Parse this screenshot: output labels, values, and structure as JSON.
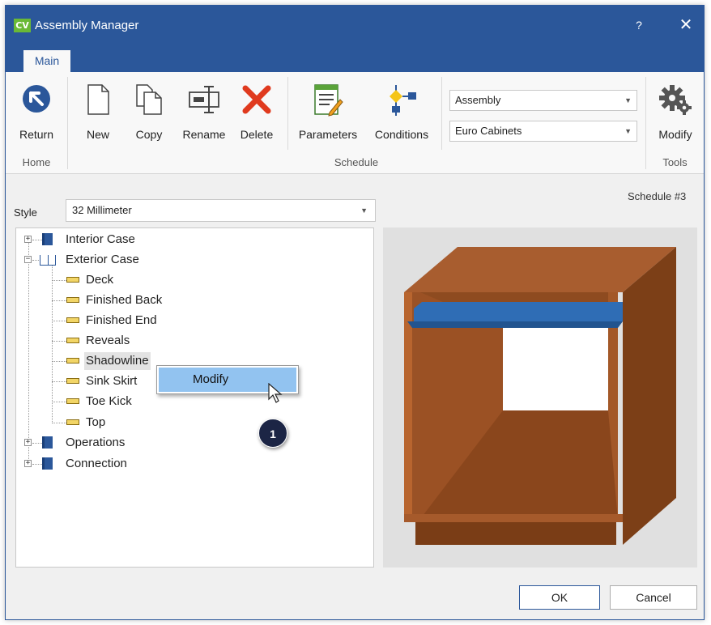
{
  "window": {
    "title": "Assembly Manager",
    "logo": "CV",
    "help": "?",
    "close": "✕"
  },
  "tabs": [
    {
      "label": "Main"
    }
  ],
  "ribbon": {
    "return_label": "Return",
    "new_label": "New",
    "copy_label": "Copy",
    "rename_label": "Rename",
    "delete_label": "Delete",
    "parameters_label": "Parameters",
    "conditions_label": "Conditions",
    "modify_label": "Modify",
    "combo_type": "Assembly",
    "combo_library": "Euro Cabinets",
    "groups": {
      "home": "Home",
      "schedule": "Schedule",
      "tools": "Tools"
    }
  },
  "schedule_number": "Schedule #3",
  "style": {
    "label": "Style",
    "value": "32 Millimeter"
  },
  "tree": {
    "interior_case": "Interior Case",
    "exterior_case": "Exterior Case",
    "children": [
      "Deck",
      "Finished Back",
      "Finished End",
      "Reveals",
      "Shadowline",
      "Sink Skirt",
      "Toe Kick",
      "Top"
    ],
    "operations": "Operations",
    "connection": "Connection"
  },
  "context_menu": {
    "item": "Modify"
  },
  "callout": "1",
  "buttons": {
    "ok": "OK",
    "cancel": "Cancel"
  },
  "colors": {
    "title_bar": "#2b579a",
    "brand_logo": "#6ab936",
    "menu_highlight": "#92c3f0",
    "cabinet_brown": "#8b4a1f",
    "shelf_blue": "#2f6db5"
  },
  "icons": [
    "return-icon",
    "new-document-icon",
    "copy-icon",
    "rename-icon",
    "delete-icon",
    "parameters-icon",
    "conditions-icon",
    "gear-icon"
  ]
}
